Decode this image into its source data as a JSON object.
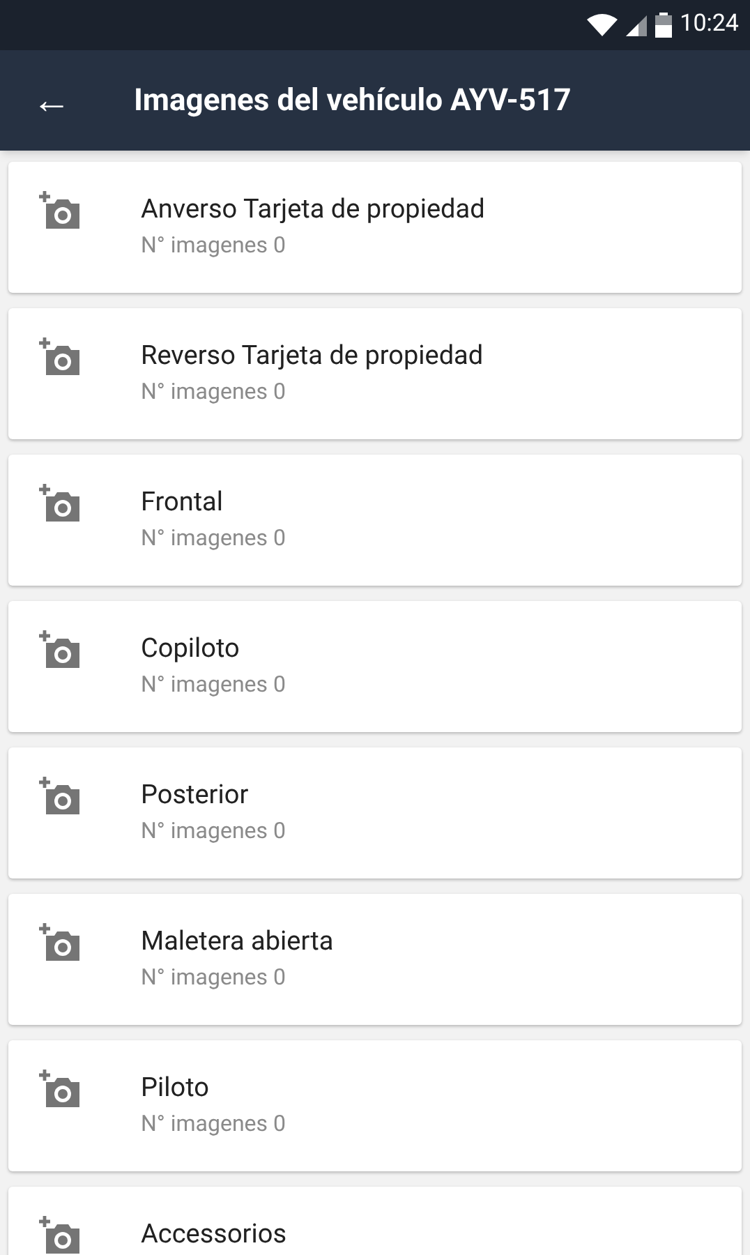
{
  "status_bar": {
    "time": "10:24"
  },
  "app_bar": {
    "back": "←",
    "title": "Imagenes del vehículo AYV-517"
  },
  "items": [
    {
      "title": "Anverso Tarjeta de propiedad",
      "subtitle": "N° imagenes 0"
    },
    {
      "title": "Reverso Tarjeta de propiedad",
      "subtitle": "N° imagenes 0"
    },
    {
      "title": "Frontal",
      "subtitle": "N° imagenes 0"
    },
    {
      "title": "Copiloto",
      "subtitle": "N° imagenes 0"
    },
    {
      "title": "Posterior",
      "subtitle": "N° imagenes 0"
    },
    {
      "title": "Maletera abierta",
      "subtitle": "N° imagenes 0"
    },
    {
      "title": "Piloto",
      "subtitle": "N° imagenes 0"
    },
    {
      "title": "Accessorios"
    }
  ]
}
